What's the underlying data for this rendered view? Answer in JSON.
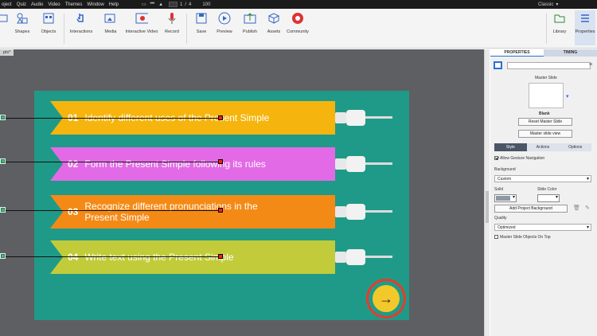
{
  "menubar": {
    "items": [
      "oject",
      "Quiz",
      "Audio",
      "Video",
      "Themes",
      "Window",
      "Help"
    ],
    "page_current": "1",
    "page_separator": "/",
    "page_total": "4",
    "zoom": "100",
    "workspace": "Classic"
  },
  "toolbar": {
    "shapes": "Shapes",
    "objects": "Objects",
    "interactions": "Interactions",
    "media": "Media",
    "interactive_video": "Interactive Video",
    "record": "Record",
    "save": "Save",
    "preview": "Preview",
    "publish": "Publish",
    "assets": "Assets",
    "community": "Community",
    "library": "Library",
    "properties": "Properties"
  },
  "canvas": {
    "tab_label": "ptx*"
  },
  "slide": {
    "background": "#209a88",
    "items": [
      {
        "num": "01",
        "text": "Identify different uses of the Present Simple",
        "color": "#f6b50e"
      },
      {
        "num": "02",
        "text": "Form the Present Simple following its rules",
        "color": "#e36ae6"
      },
      {
        "num": "03",
        "text": "Recognize different pronunciations in the Present Simple",
        "color": "#f48a16"
      },
      {
        "num": "04",
        "text": "Write text using the Present Simple",
        "color": "#c2cc3a"
      }
    ],
    "next_icon": "arrow-right-icon"
  },
  "panel": {
    "tab_properties": "PROPERTIES",
    "tab_timing": "TIMING",
    "master_slide_label": "Master Slide",
    "master_slide_name": "Blank",
    "reset_master": "Reset Master Slide",
    "master_view": "Master slide view",
    "subtabs": [
      "Style",
      "Actions",
      "Options"
    ],
    "allow_gesture": "Allow Gesture Navigation",
    "background_label": "Background",
    "background_value": "Custom",
    "solid_label": "Solid",
    "slide_color_label": "Slide Color",
    "add_project_bg": "Add Project Background",
    "quality_label": "Quality",
    "quality_value": "Optimized",
    "master_on_top": "Master Slide Objects On Top"
  }
}
